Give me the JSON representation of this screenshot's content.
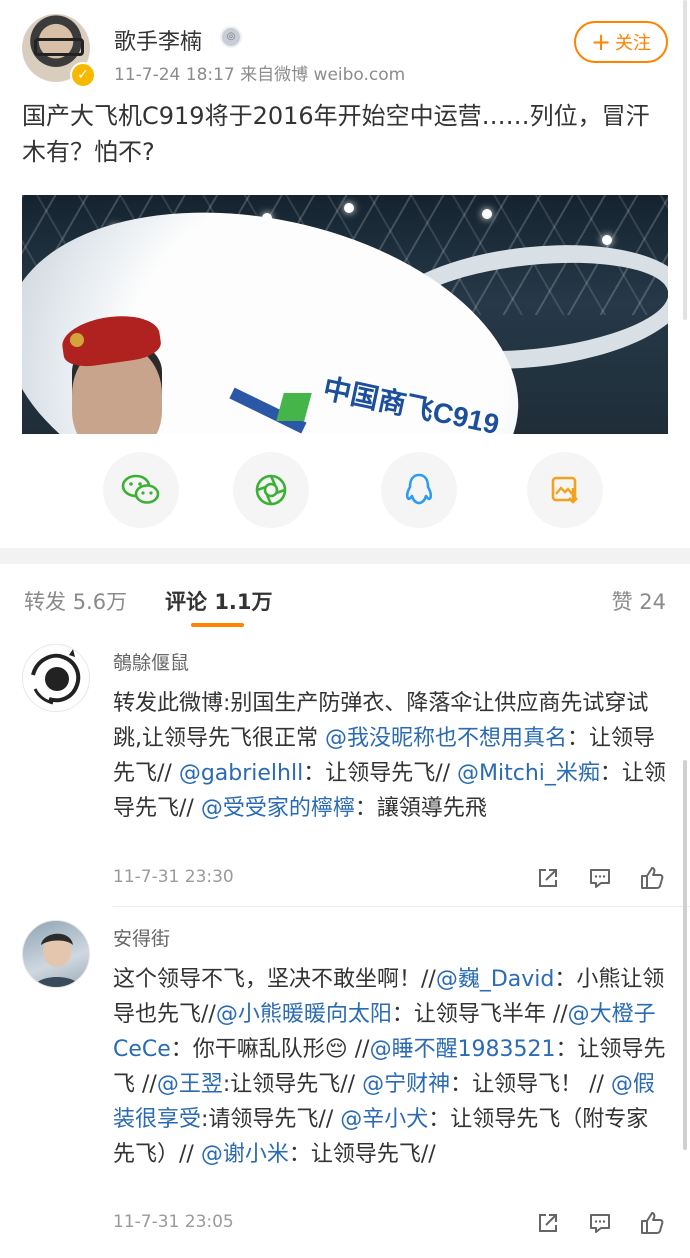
{
  "post": {
    "author": "歌手李楠",
    "meta": "11-7-24 18:17  来自微博 weibo.com",
    "follow_label": "关注",
    "text": "国产大飞机C919将于2016年开始空中运营……列位，冒汗木有？怕不?",
    "image_logo_text": "中国商飞C919"
  },
  "share": {
    "icons": [
      "wechat-icon",
      "moments-icon",
      "qq-icon",
      "save-image-icon"
    ]
  },
  "tabs": {
    "repost_label": "转发",
    "repost_count": "5.6万",
    "comment_label": "评论",
    "comment_count": "1.1万",
    "like_label": "赞",
    "like_count": "24"
  },
  "comments": [
    {
      "name": "鵸鵌偃鼠",
      "segments": [
        {
          "t": "转发此微博:别国生产防弹衣、降落伞让供应商先试穿试跳,让领导先飞很正常 ",
          "m": false
        },
        {
          "t": "@我没昵称也不想用真名",
          "m": true
        },
        {
          "t": "：让领导先飞// ",
          "m": false
        },
        {
          "t": "@gabrielhll",
          "m": true
        },
        {
          "t": "：让领导先飞// ",
          "m": false
        },
        {
          "t": "@Mitchi_米痴",
          "m": true
        },
        {
          "t": "：让领导先飞// ",
          "m": false
        },
        {
          "t": "@受受家的檸檸",
          "m": true
        },
        {
          "t": "：讓領導先飛",
          "m": false
        }
      ],
      "time": "11-7-31 23:30"
    },
    {
      "name": "安得街",
      "segments": [
        {
          "t": "这个领导不飞，坚决不敢坐啊！//",
          "m": false
        },
        {
          "t": "@巍_David",
          "m": true
        },
        {
          "t": "：小熊让领导也先飞//",
          "m": false
        },
        {
          "t": "@小熊暖暖向太阳",
          "m": true
        },
        {
          "t": "：让领导飞半年 //",
          "m": false
        },
        {
          "t": "@大橙子CeCe",
          "m": true
        },
        {
          "t": "：你干嘛乱队形😔 //",
          "m": false
        },
        {
          "t": "@睡不醒1983521",
          "m": true
        },
        {
          "t": "：让领导先飞 //",
          "m": false
        },
        {
          "t": "@王翌",
          "m": true
        },
        {
          "t": ":让领导先飞// ",
          "m": false
        },
        {
          "t": "@宁财神",
          "m": true
        },
        {
          "t": "：让领导飞！ // ",
          "m": false
        },
        {
          "t": "@假装很享受",
          "m": true
        },
        {
          "t": ":请领导先飞// ",
          "m": false
        },
        {
          "t": "@辛小犬",
          "m": true
        },
        {
          "t": "：让领导先飞（附专家先飞）// ",
          "m": false
        },
        {
          "t": "@谢小米",
          "m": true
        },
        {
          "t": "：让领导先飞//",
          "m": false
        }
      ],
      "time": "11-7-31 23:05"
    }
  ],
  "colors": {
    "accent": "#ff8200",
    "mention": "#2a6bb3",
    "wechat": "#3cb034",
    "qq": "#2f9bf0",
    "save": "#f2a21d"
  }
}
